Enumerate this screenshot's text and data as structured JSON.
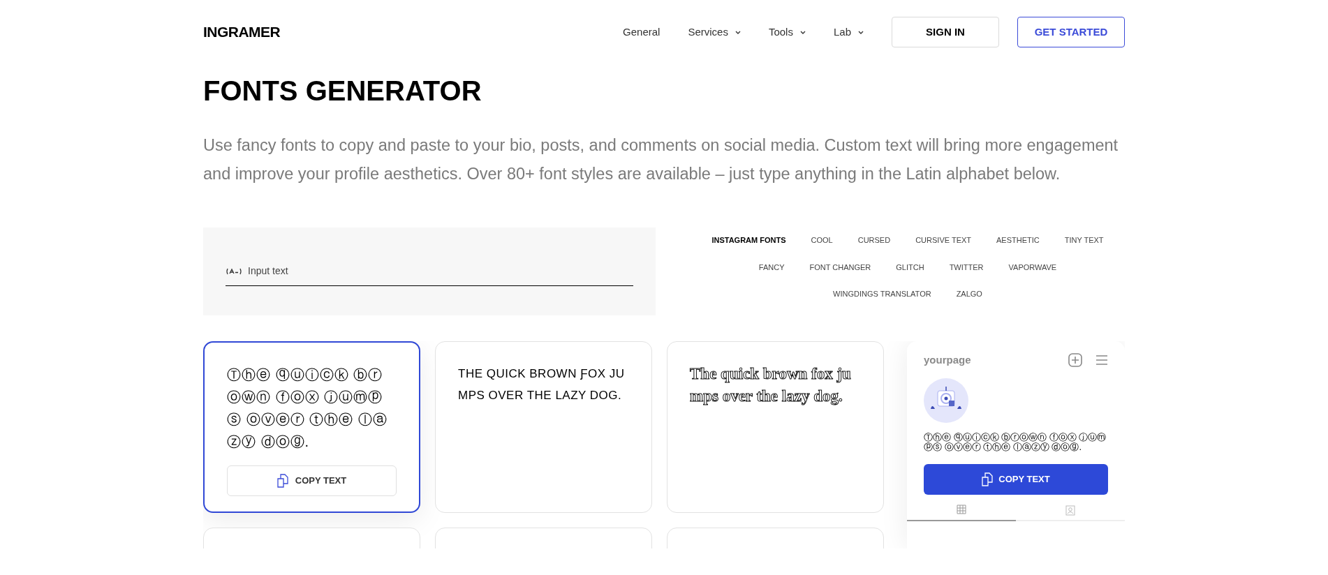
{
  "logo": "INGRAMER",
  "nav": [
    {
      "label": "General",
      "has_menu": false
    },
    {
      "label": "Services",
      "has_menu": true
    },
    {
      "label": "Tools",
      "has_menu": true
    },
    {
      "label": "Lab",
      "has_menu": true
    }
  ],
  "header_buttons": [
    {
      "label": "SIGN IN",
      "kind": "plain"
    },
    {
      "label": "GET STARTED",
      "kind": "outline"
    }
  ],
  "title": "FONTS GENERATOR",
  "intro": "Use fancy fonts to copy and paste to your bio, posts, and comments on social media. Custom text will bring more engagement and improve your profile aesthetics. Over 80+ font styles are available – just type anything in the Latin alphabet below.",
  "input": {
    "placeholder": "Input text"
  },
  "tabs": [
    [
      {
        "label": "INSTAGRAM FONTS",
        "selected": true
      },
      {
        "label": "COOL",
        "selected": false
      },
      {
        "label": "CURSED",
        "selected": false
      },
      {
        "label": "CURSIVE TEXT",
        "selected": false
      },
      {
        "label": "AESTHETIC",
        "selected": false
      },
      {
        "label": "TINY TEXT",
        "selected": false
      }
    ],
    [
      {
        "label": "FANCY",
        "selected": false
      },
      {
        "label": "FONT CHANGER",
        "selected": false
      },
      {
        "label": "GLITCH",
        "selected": false
      },
      {
        "label": "TWITTER",
        "selected": false
      },
      {
        "label": "VAPORWAVE",
        "selected": false
      }
    ],
    [
      {
        "label": "WINGDINGS TRANSLATOR",
        "selected": false
      },
      {
        "label": "ZALGO",
        "selected": false
      }
    ]
  ],
  "font_cards": [
    {
      "kind": "circled",
      "text": "Ⓣⓗⓔ ⓠⓤⓘⓒⓚ ⓑⓡⓞⓦⓝ ⓕⓞⓧ ⓙⓤⓜⓟⓢ ⓞⓥⓔⓡ ⓣⓗⓔ ⓛⓐⓩⓨ ⓓⓞⓖ.",
      "selected": true,
      "button": "COPY TEXT"
    },
    {
      "kind": "caps",
      "text": "THE QUICK BROWN ƑOX JUMPS OVER THE LAZY DOG.",
      "selected": false
    },
    {
      "kind": "outline",
      "text": "The quick brown fox jumps over the lazy dog.",
      "selected": false
    },
    {
      "selected": false
    },
    {
      "selected": false
    },
    {
      "selected": false
    }
  ],
  "preview": {
    "username": "yourpage",
    "text": "Ⓣⓗⓔ ⓠⓤⓘⓒⓚ ⓑⓡⓞⓦⓝ ⓕⓞⓧ ⓙⓤⓜⓟⓢ ⓞⓥⓔⓡ ⓣⓗⓔ ⓛⓐⓩⓨ ⓓⓞⓖ.",
    "button": "COPY TEXT",
    "tabs": [
      {
        "kind": "grid",
        "selected": true
      },
      {
        "kind": "tagged",
        "selected": false
      }
    ]
  }
}
